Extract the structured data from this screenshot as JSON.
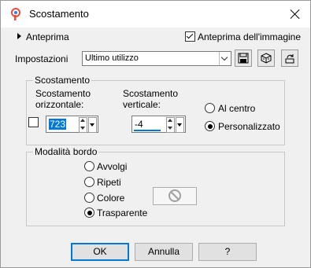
{
  "window": {
    "title": "Scostamento"
  },
  "preview": {
    "toggle_label": "Anteprima",
    "image_preview_label": "Anteprima dell'immagine",
    "image_preview_checked": true
  },
  "settings": {
    "label": "Impostazioni",
    "selected": "Ultimo utilizzo"
  },
  "offset_group": {
    "title": "Scostamento",
    "horizontal_label_1": "Scostamento",
    "horizontal_label_2": "orizzontale:",
    "horizontal_value": "723",
    "vertical_label_1": "Scostamento",
    "vertical_label_2": "verticale:",
    "vertical_value": "-4",
    "center_label": "Al centro",
    "custom_label": "Personalizzato",
    "selected": "custom"
  },
  "border_group": {
    "title": "Modalità bordo",
    "options": [
      "Avvolgi",
      "Ripeti",
      "Colore",
      "Trasparente"
    ],
    "selected": "Trasparente"
  },
  "buttons": {
    "ok": "OK",
    "cancel": "Annulla",
    "help": "?"
  },
  "colors": {
    "accent": "#0078d7",
    "brand": "#e84c3d"
  }
}
